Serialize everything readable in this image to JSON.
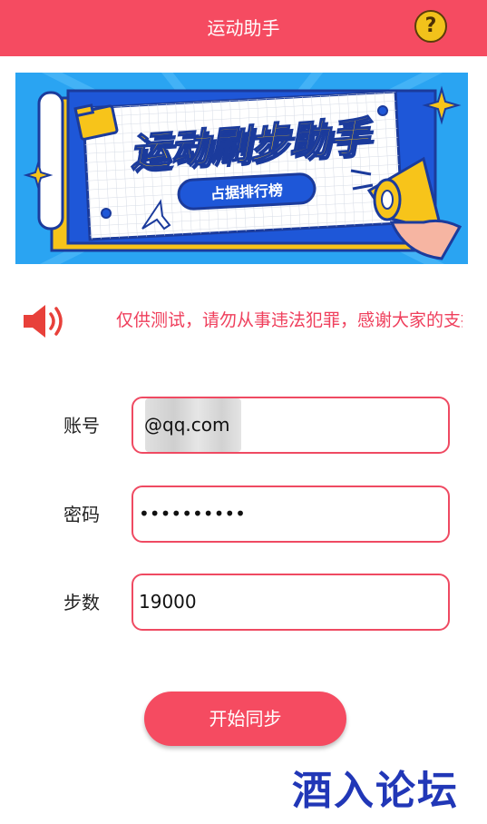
{
  "header": {
    "title": "运动助手",
    "help_icon": "question-mark-icon",
    "help_symbol": "?"
  },
  "banner": {
    "title": "运动刷步助手",
    "subtitle": "占据排行榜"
  },
  "notice": {
    "icon": "speaker-icon",
    "text": "仅供测试，请勿从事违法犯罪，感谢大家的支持"
  },
  "form": {
    "account": {
      "label": "账号",
      "value_prefix": "1",
      "value_suffix": "@qq.com"
    },
    "password": {
      "label": "密码",
      "value": "••••••••••"
    },
    "steps": {
      "label": "步数",
      "value": "19000"
    }
  },
  "actions": {
    "start_label": "开始同步"
  },
  "watermark": {
    "text": "酒入论坛"
  },
  "colors": {
    "brand": "#f54b61",
    "accent_text": "#ef3f5c",
    "watermark": "#2137b7"
  }
}
